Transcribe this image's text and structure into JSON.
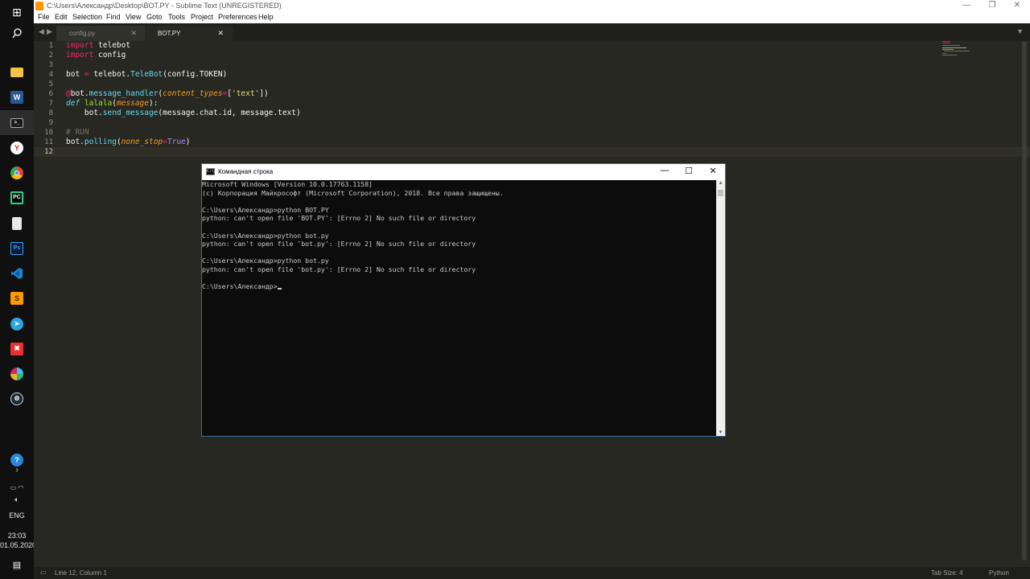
{
  "taskbar": {
    "items": [
      {
        "name": "start",
        "glyph": "⊞",
        "color": "#ffffff"
      },
      {
        "name": "search",
        "glyph": "⌕",
        "color": "#ffffff"
      },
      {
        "name": "file-explorer",
        "glyph": "",
        "color": "#f4c246"
      },
      {
        "name": "word",
        "glyph": "W",
        "color": "#2b5797"
      },
      {
        "name": "command-prompt",
        "glyph": ">_",
        "color": "#2b2b2b"
      },
      {
        "name": "yandex-browser",
        "glyph": "Y",
        "color": "#e02020"
      },
      {
        "name": "chrome",
        "glyph": "",
        "color": "#34a853"
      },
      {
        "name": "pycharm",
        "glyph": "PC",
        "color": "#21d789"
      },
      {
        "name": "notepad",
        "glyph": "",
        "color": "#dddddd"
      },
      {
        "name": "photoshop",
        "glyph": "Ps",
        "color": "#0b1a33"
      },
      {
        "name": "vscode",
        "glyph": "",
        "color": "#1b82d2"
      },
      {
        "name": "sublime-text",
        "glyph": "S",
        "color": "#ff9800"
      },
      {
        "name": "telegram",
        "glyph": "",
        "color": "#2ca5e0"
      },
      {
        "name": "xmind",
        "glyph": "✖",
        "color": "#e83030"
      },
      {
        "name": "slack",
        "glyph": "",
        "color": "#ffffff"
      },
      {
        "name": "steam",
        "glyph": "",
        "color": "#1b2838"
      }
    ],
    "language": "ENG",
    "time": "23:03",
    "date": "01.05.2020"
  },
  "sublime": {
    "title": "C:\\Users\\Александр\\Desktop\\BOT.PY - Sublime Text (UNREGISTERED)",
    "menu": [
      "File",
      "Edit",
      "Selection",
      "Find",
      "View",
      "Goto",
      "Tools",
      "Project",
      "Preferences",
      "Help"
    ],
    "tabs": [
      {
        "label": "config.py",
        "active": false
      },
      {
        "label": "BOT.PY",
        "active": true
      }
    ],
    "line_numbers": [
      "1",
      "2",
      "3",
      "4",
      "5",
      "6",
      "7",
      "8",
      "9",
      "10",
      "11",
      "12"
    ],
    "code": {
      "l1_kw": "import",
      "l1_rest": " telebot",
      "l2_kw": "import",
      "l2_rest": " config",
      "l4_a": "bot ",
      "l4_eq": "=",
      "l4_b": " telebot.",
      "l4_fn": "TeleBot",
      "l4_c": "(config.TOKEN)",
      "l6_at": "@",
      "l6_a": "bot.",
      "l6_fn": "message_handler",
      "l6_b": "(",
      "l6_param": "content_types",
      "l6_eq": "=",
      "l6_c": "[",
      "l6_str": "'text'",
      "l6_d": "])",
      "l7_def": "def",
      "l7_name": " lalala",
      "l7_a": "(",
      "l7_param": "message",
      "l7_b": "):",
      "l8_a": "    bot.",
      "l8_fn": "send_message",
      "l8_b": "(message.chat.id, message.text)",
      "l10_cmt": "# RUN",
      "l11_a": "bot.",
      "l11_fn": "polling",
      "l11_b": "(",
      "l11_param": "none_stop",
      "l11_eq": "=",
      "l11_const": "True",
      "l11_c": ")"
    },
    "status_left": "Line 12, Column 1",
    "tab_size": "Tab Size: 4",
    "syntax": "Python"
  },
  "cmd": {
    "title": "Командная строка",
    "icon_text": "C:\\",
    "lines": [
      "Microsoft Windows [Version 10.0.17763.1158]",
      "(c) Корпорация Майкрософт (Microsoft Corporation), 2018. Все права защищены.",
      "",
      "C:\\Users\\Александр>python BOT.PY",
      "python: can't open file 'BOT.PY': [Errno 2] No such file or directory",
      "",
      "C:\\Users\\Александр>python bot.py",
      "python: can't open file 'bot.py': [Errno 2] No such file or directory",
      "",
      "C:\\Users\\Александр>python bot.py",
      "python: can't open file 'bot.py': [Errno 2] No such file or directory",
      "",
      "C:\\Users\\Александр>"
    ]
  },
  "colors": {
    "editor_bg": "#272822",
    "keyword": "#f92672",
    "function": "#66d9ef",
    "string": "#e6db74",
    "parameter": "#fd971f",
    "constant": "#ae81ff",
    "comment": "#75715e"
  }
}
